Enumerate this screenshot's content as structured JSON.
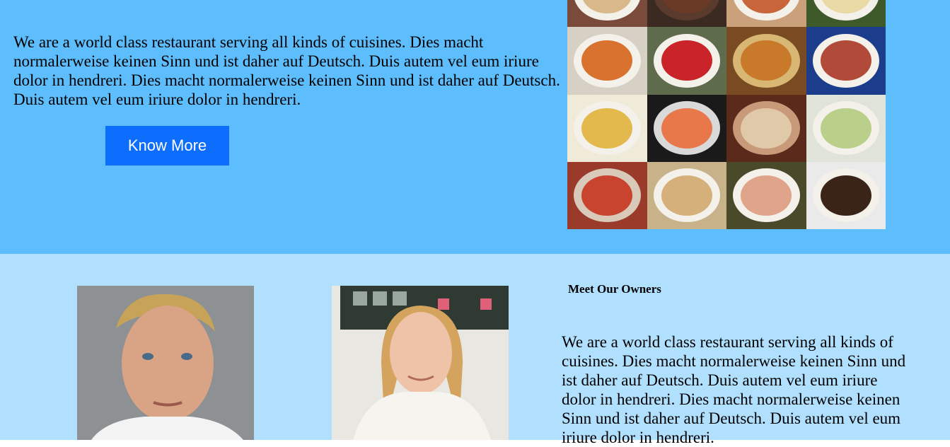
{
  "hero": {
    "description": "We are a world class restaurant serving all kinds of cuisines. Dies macht normalerweise keinen Sinn und ist daher auf Deutsch. Duis autem vel eum iriure dolor in hendreri. Dies macht normalerweise keinen Sinn und ist daher auf Deutsch. Duis autem vel eum iriure dolor in hendreri.",
    "button_label": "Know More"
  },
  "owners": {
    "heading": "Meet Our Owners",
    "description": "We are a world class restaurant serving all kinds of cuisines. Dies macht normalerweise keinen Sinn und ist daher auf Deutsch. Duis autem vel eum iriure dolor in hendreri. Dies macht normalerweise keinen Sinn und ist daher auf Deutsch. Duis autem vel eum iriure dolor in hendreri."
  },
  "colors": {
    "hero_bg": "#5ebdfc",
    "owners_bg": "#b1e0fe",
    "button_bg": "#0d6efd"
  }
}
